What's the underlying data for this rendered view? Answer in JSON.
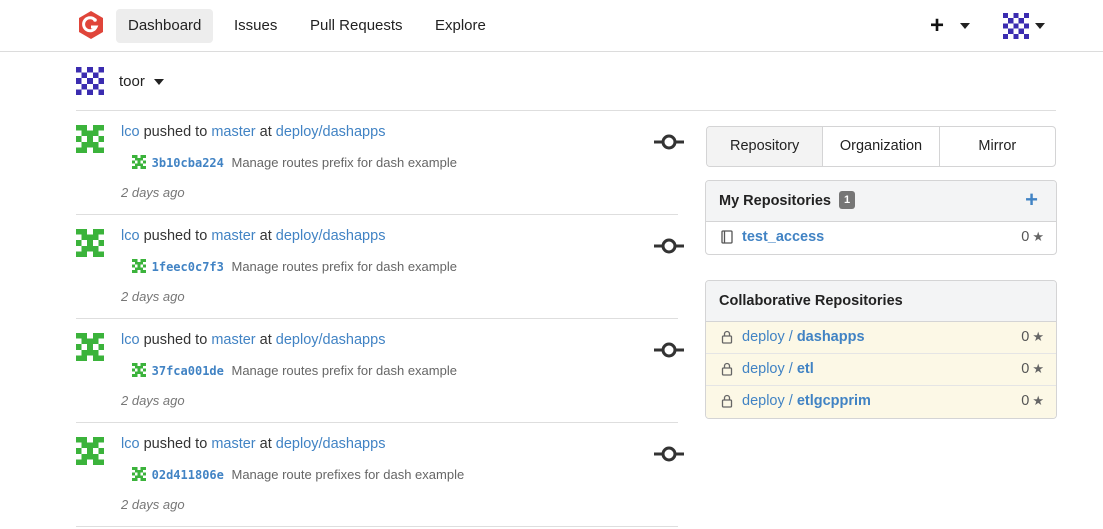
{
  "nav": {
    "items": [
      {
        "label": "Dashboard",
        "active": true
      },
      {
        "label": "Issues",
        "active": false
      },
      {
        "label": "Pull Requests",
        "active": false
      },
      {
        "label": "Explore",
        "active": false
      }
    ],
    "plus_symbol": "+"
  },
  "context": {
    "user": "toor"
  },
  "feed": [
    {
      "user": "lco",
      "action": "pushed to",
      "branch": "master",
      "at": "at",
      "repo": "deploy/dashapps",
      "sha": "3b10cba224",
      "message": "Manage routes prefix for dash example",
      "time": "2 days ago"
    },
    {
      "user": "lco",
      "action": "pushed to",
      "branch": "master",
      "at": "at",
      "repo": "deploy/dashapps",
      "sha": "1feec0c7f3",
      "message": "Manage routes prefix for dash example",
      "time": "2 days ago"
    },
    {
      "user": "lco",
      "action": "pushed to",
      "branch": "master",
      "at": "at",
      "repo": "deploy/dashapps",
      "sha": "37fca001de",
      "message": "Manage routes prefix for dash example",
      "time": "2 days ago"
    },
    {
      "user": "lco",
      "action": "pushed to",
      "branch": "master",
      "at": "at",
      "repo": "deploy/dashapps",
      "sha": "02d411806e",
      "message": "Manage route prefixes for dash example",
      "time": "2 days ago"
    }
  ],
  "repo_tabs": [
    "Repository",
    "Organization",
    "Mirror"
  ],
  "my_repos": {
    "title": "My Repositories",
    "count": "1",
    "add_symbol": "+",
    "items": [
      {
        "name": "test_access",
        "stars": "0"
      }
    ]
  },
  "collab_repos": {
    "title": "Collaborative Repositories",
    "items": [
      {
        "owner": "deploy",
        "sep": "/",
        "name": "dashapps",
        "stars": "0"
      },
      {
        "owner": "deploy",
        "sep": "/",
        "name": "etl",
        "stars": "0"
      },
      {
        "owner": "deploy",
        "sep": "/",
        "name": "etlgcpprim",
        "stars": "0"
      }
    ]
  },
  "icons": {
    "logo": "gitea-logo-icon",
    "commit": "commit-icon",
    "repo": "repo-book-icon",
    "lock": "lock-icon",
    "star": "star-icon"
  },
  "colors": {
    "link": "#4183c4",
    "logo": "#e0453a",
    "identicon_green": "#3bb33b",
    "identicon_purple": "#3b2cb0",
    "collab_bg": "#fcf8e6"
  }
}
